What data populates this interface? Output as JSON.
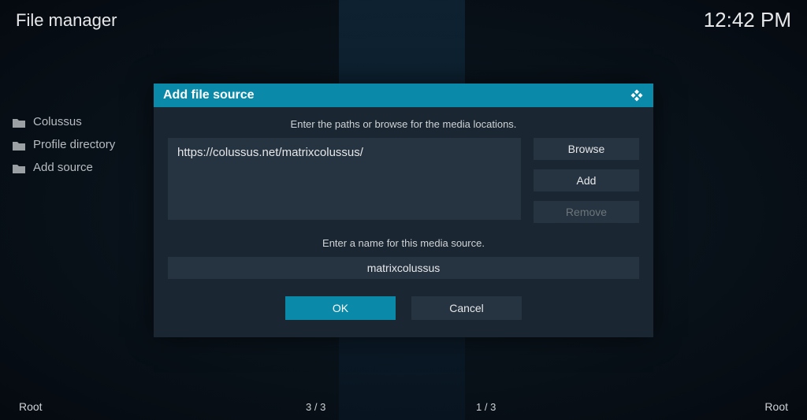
{
  "header": {
    "title": "File manager",
    "time": "12:42 PM"
  },
  "sidebar": {
    "items": [
      {
        "label": "Colussus"
      },
      {
        "label": "Profile directory"
      },
      {
        "label": "Add source"
      }
    ]
  },
  "dialog": {
    "title": "Add file source",
    "prompt_paths": "Enter the paths or browse for the media locations.",
    "url": "https://colussus.net/matrixcolussus/",
    "browse": "Browse",
    "add": "Add",
    "remove": "Remove",
    "prompt_name": "Enter a name for this media source.",
    "name": "matrixcolussus",
    "ok": "OK",
    "cancel": "Cancel"
  },
  "footer": {
    "left": "Root",
    "center_left": "3 / 3",
    "center_right": "1 / 3",
    "right": "Root"
  }
}
